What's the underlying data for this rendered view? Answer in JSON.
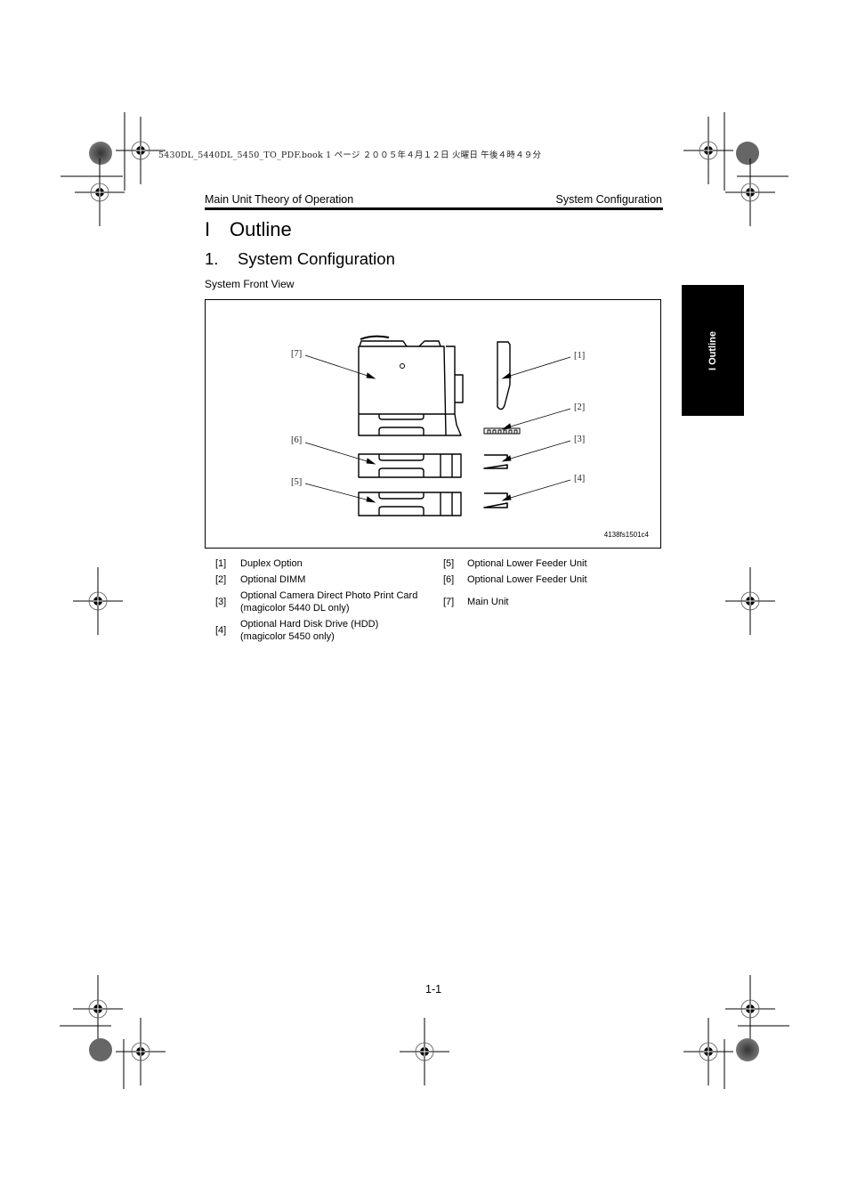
{
  "slug": "5430DL_5440DL_5450_TO_PDF.book  1 ページ  ２００５年４月１２日  火曜日  午後４時４９分",
  "running_header": {
    "left": "Main Unit Theory of Operation",
    "right": "System Configuration"
  },
  "heading1": {
    "number": "I",
    "title": "Outline"
  },
  "heading2": {
    "number": "1.",
    "title": "System Configuration"
  },
  "figure": {
    "caption": "System Front View",
    "id": "4138fs1501c4",
    "callouts": [
      "[1]",
      "[2]",
      "[3]",
      "[4]",
      "[5]",
      "[6]",
      "[7]"
    ]
  },
  "side_tab": {
    "label": "I Outline"
  },
  "legend": {
    "rows": [
      {
        "left_key": "[1]",
        "left_text": "Duplex Option",
        "left_sub": "",
        "right_key": "[5]",
        "right_text": "Optional Lower Feeder Unit"
      },
      {
        "left_key": "[2]",
        "left_text": "Optional DIMM",
        "left_sub": "",
        "right_key": "[6]",
        "right_text": "Optional Lower Feeder Unit"
      },
      {
        "left_key": "[3]",
        "left_text": "Optional Camera Direct Photo Print Card",
        "left_sub": "(magicolor 5440 DL only)",
        "right_key": "[7]",
        "right_text": "Main Unit"
      },
      {
        "left_key": "[4]",
        "left_text": "Optional Hard Disk Drive (HDD)",
        "left_sub": "(magicolor 5450 only)",
        "right_key": "",
        "right_text": ""
      }
    ]
  },
  "page_number": "1-1"
}
